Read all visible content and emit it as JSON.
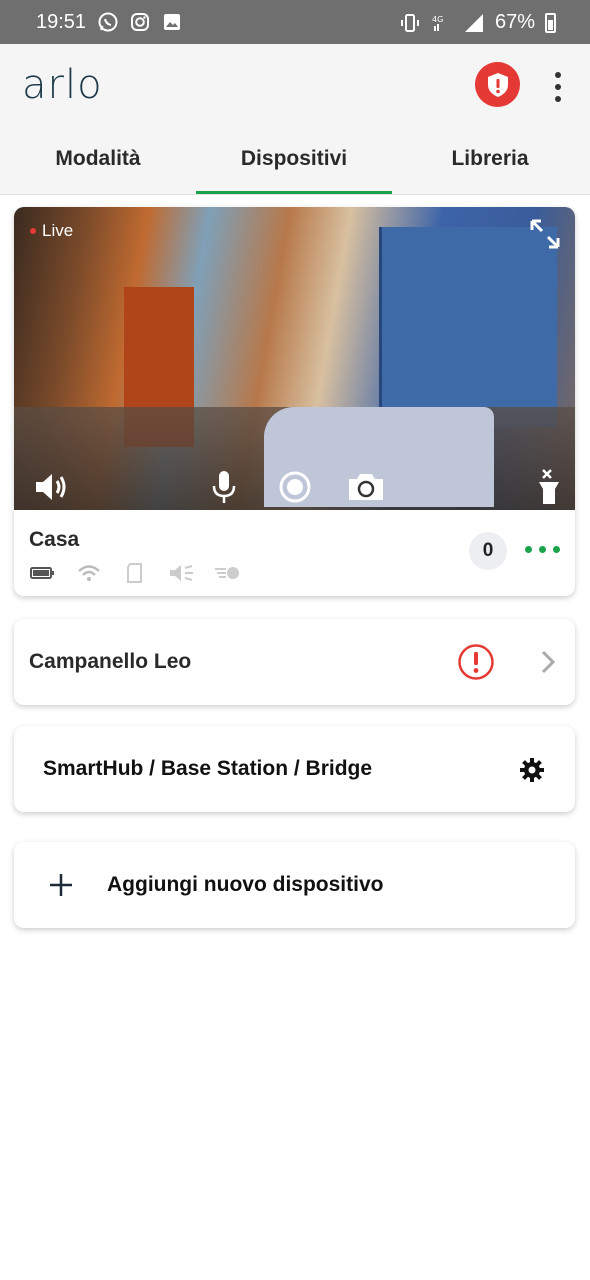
{
  "status_bar": {
    "time": "19:51",
    "battery_percent": "67%",
    "icons_left": [
      "whatsapp-icon",
      "instagram-icon",
      "image-icon"
    ],
    "icons_right": [
      "vibrate-icon",
      "signal-4g-icon",
      "signal-bars-icon",
      "battery-icon"
    ]
  },
  "app": {
    "logo": "arlo",
    "accent_color": "#1aa34a",
    "alert_color": "#e53935"
  },
  "tabs": [
    {
      "label": "Modalità",
      "active": false
    },
    {
      "label": "Dispositivi",
      "active": true
    },
    {
      "label": "Libreria",
      "active": false
    }
  ],
  "camera": {
    "live_label": "Live",
    "name": "Casa",
    "event_count": "0",
    "controls": [
      "speaker-icon",
      "microphone-icon",
      "record-icon",
      "snapshot-icon",
      "spotlight-off-icon"
    ],
    "status_icons": [
      "battery-icon",
      "wifi-icon",
      "sd-card-icon",
      "speaker-muted-icon",
      "motion-icon"
    ]
  },
  "devices": [
    {
      "label": "Campanello Leo",
      "icon": "alert-icon"
    },
    {
      "label": "SmartHub / Base Station / Bridge",
      "icon": "gear-icon"
    }
  ],
  "add_device": {
    "label": "Aggiungi nuovo dispositivo"
  }
}
